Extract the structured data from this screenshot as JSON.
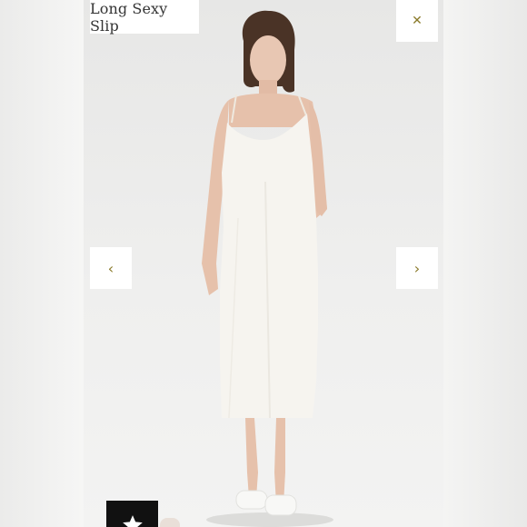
{
  "product": {
    "title": "Long Sexy Slip"
  },
  "controls": {
    "close_icon": "close-icon",
    "prev_icon": "chevron-left-icon",
    "next_icon": "chevron-right-icon",
    "accent_color": "#8a7a2a"
  },
  "badge": {
    "icon": "star-icon",
    "color": "#111111"
  }
}
